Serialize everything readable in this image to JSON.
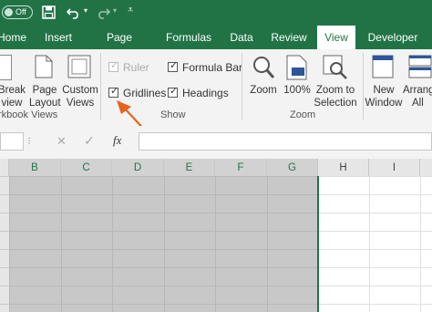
{
  "titlebar": {
    "autosave_label": "Off"
  },
  "tabs": [
    "Home",
    "Insert",
    "Page Layout",
    "Formulas",
    "Data",
    "Review",
    "View",
    "Developer"
  ],
  "active_tab": "View",
  "ribbon": {
    "workbook_views": {
      "buttons": [
        {
          "line1": "Break",
          "line2": "view"
        },
        {
          "line1": "Page",
          "line2": "Layout"
        },
        {
          "line1": "Custom",
          "line2": "Views"
        }
      ],
      "label": "rkbook Views"
    },
    "show": {
      "ruler": "Ruler",
      "formula_bar": "Formula Bar",
      "gridlines": "Gridlines",
      "headings": "Headings",
      "label": "Show"
    },
    "zoom": {
      "buttons": [
        {
          "line1": "Zoom",
          "line2": ""
        },
        {
          "line1": "100%",
          "line2": ""
        },
        {
          "line1": "Zoom to",
          "line2": "Selection"
        }
      ],
      "label": "Zoom"
    },
    "window": {
      "buttons": [
        {
          "line1": "New",
          "line2": "Window"
        },
        {
          "line1": "Arrang",
          "line2": "All"
        }
      ]
    }
  },
  "formula_bar": {
    "cancel_glyph": "✕",
    "enter_glyph": "✓",
    "fx_label": "fx"
  },
  "columns": [
    "B",
    "C",
    "D",
    "E",
    "F",
    "G",
    "H",
    "I"
  ],
  "colors": {
    "brand_green": "#217346",
    "annotation_arrow": "#e8621a"
  }
}
